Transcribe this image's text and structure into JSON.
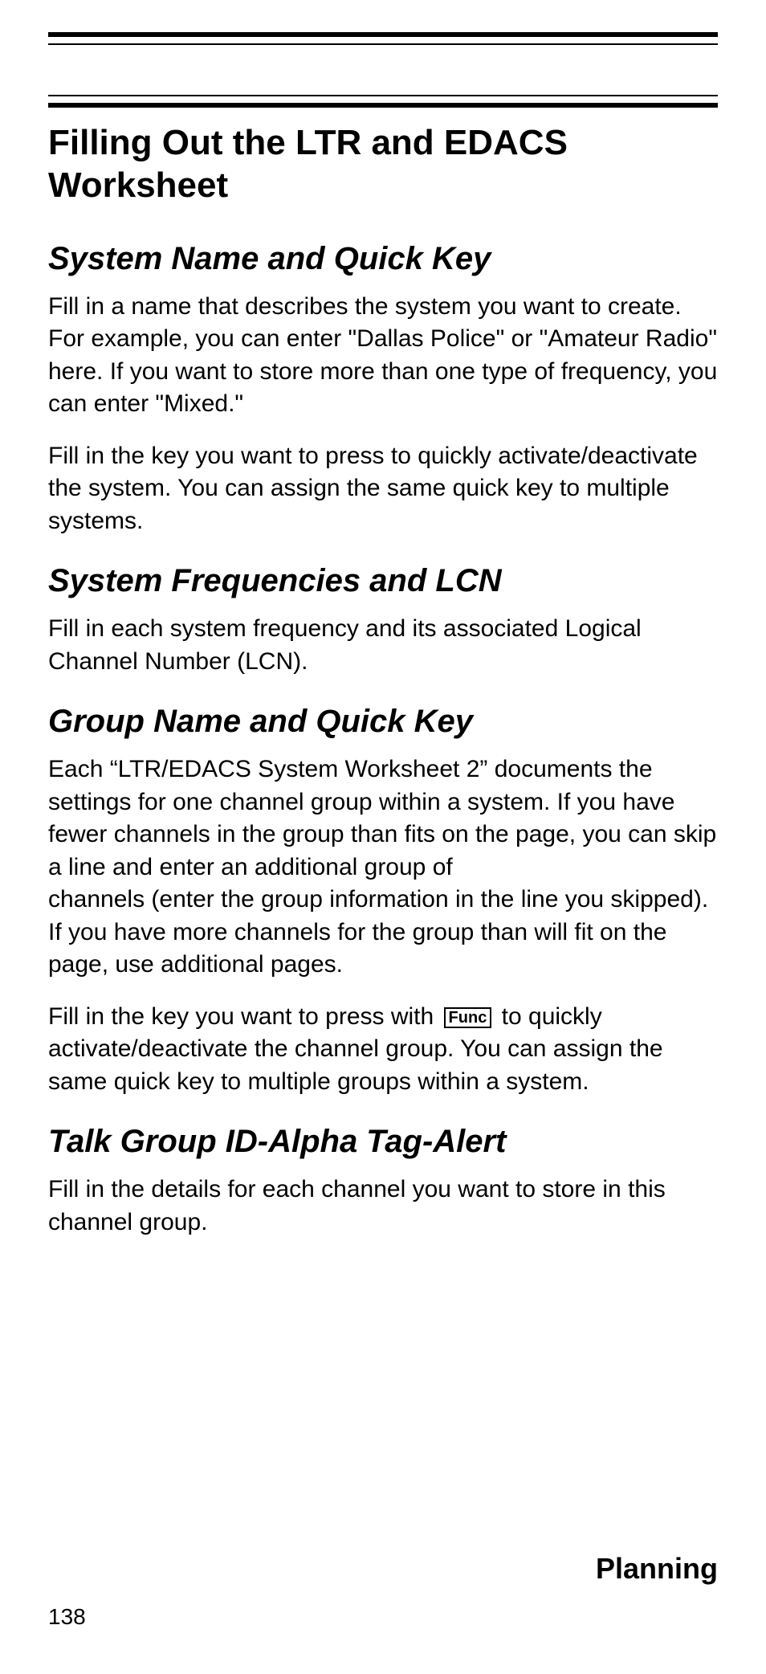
{
  "heading": "Filling Out the LTR and EDACS Worksheet",
  "sections": {
    "s1": {
      "title": "System Name and Quick Key",
      "p1": "Fill in a name that describes the system you want to create. For example, you can enter \"Dallas Police\" or \"Amateur Radio\" here. If you want to store more than one type of frequency, you can enter \"Mixed.\"",
      "p2": "Fill in the key you want to press to quickly activate/deactivate the system. You can assign the same quick key to multiple systems."
    },
    "s2": {
      "title": "System Frequencies and LCN",
      "p1": "Fill in each system frequency and its associated Logical Channel Number (LCN)."
    },
    "s3": {
      "title": "Group Name and Quick Key",
      "p1a": "Each “LTR/EDACS System Worksheet 2” documents the settings for one channel group within a system. If you have fewer channels in the group than fits on the page, you can skip a line and enter an additional group of",
      "p1b": "channels (enter the group information in the line you skipped). If you have more channels for the group than will fit on the page, use additional pages.",
      "p2_pre": "Fill in the key you want to press with ",
      "func_label": "Func",
      "p2_post": " to quickly activate/deactivate the channel group. You can assign the same quick key to multiple groups within a system."
    },
    "s4": {
      "title": "Talk Group ID-Alpha Tag-Alert",
      "p1": "Fill in the details for each channel you want to store in this channel group."
    }
  },
  "footer_label": "Planning",
  "page_number": "138"
}
